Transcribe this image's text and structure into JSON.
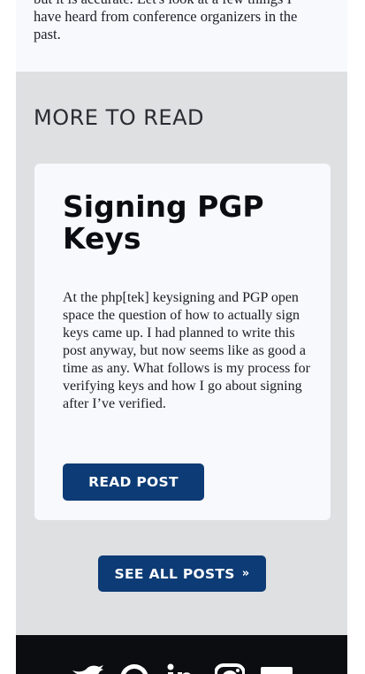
{
  "article": {
    "tail_text": "but it is accurate. Let's look at a few things I have heard from conference organizers in the past."
  },
  "more": {
    "heading": "MORE TO READ",
    "card": {
      "title": "Signing PGP Keys",
      "excerpt": "At the php[tek] keysigning and PGP open space the question of how to actually sign keys came up. I had planned to write this post anyway, but now seems like as good a time as any. What follows is my process for verifying keys and how I go about signing after I’ve verified.",
      "read_label": "READ POST"
    },
    "see_all_label": "SEE ALL POSTS",
    "see_all_icon": "»"
  },
  "footer": {
    "social_icons": [
      "twitter-icon",
      "github-icon",
      "linkedin-icon",
      "instagram-icon",
      "email-icon"
    ]
  },
  "colors": {
    "button": "#0d3b75",
    "section_bg": "#dfe0e2",
    "card_bg": "#f8f9fc",
    "footer_bg": "#0c0d10"
  }
}
